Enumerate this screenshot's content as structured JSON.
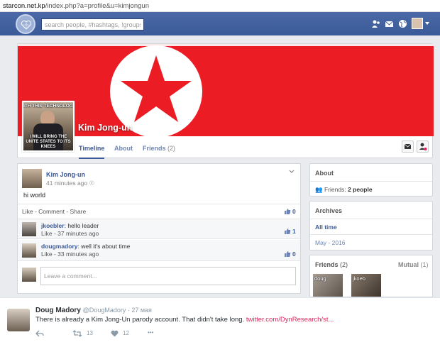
{
  "browser": {
    "url_host": "starcon.net.kp",
    "url_path": "/index.php?a=profile&u=kimjongun"
  },
  "header": {
    "search_placeholder": "search people, #hashtags, !groups",
    "icons": [
      "friends-icon",
      "messages-icon",
      "globe-icon"
    ]
  },
  "profile": {
    "name": "Kim Jong-un",
    "picture_text_top": "ITH THIS TECHNOLOG",
    "picture_text_bottom": "I WILL BRING THE UNITE STATES TO ITS KNEES",
    "tabs": [
      {
        "label": "Timeline",
        "count": ""
      },
      {
        "label": "About",
        "count": ""
      },
      {
        "label": "Friends",
        "count": "(2)"
      }
    ],
    "accent_color": "#3b5998",
    "cover_color": "#ec1c24"
  },
  "post": {
    "author": "Kim Jong-un",
    "time": "41 minutes ago",
    "text": "hi world",
    "actions": "Like - Comment - Share",
    "likes": "0",
    "comments": [
      {
        "user": "jkoebler",
        "text": ": hello leader",
        "meta": "Like - 37 minutes ago",
        "likes": "1"
      },
      {
        "user": "dougmadory",
        "text": ": well it's about time",
        "meta": "Like - 33 minutes ago",
        "likes": "0"
      }
    ],
    "comment_placeholder": "Leave a comment..."
  },
  "sidebar": {
    "about_title": "About",
    "friends_label": "Friends:",
    "friends_value": "2 people",
    "archives_title": "Archives",
    "archives_all": "All time",
    "archives_month": "May - 2016",
    "friends_title": "Friends",
    "friends_count": "(2)",
    "mutual_title": "Mutual",
    "mutual_count": "(1)",
    "friend_thumbs": [
      "doug",
      "jkoeb"
    ]
  },
  "tweet": {
    "name": "Doug Madory",
    "handle": "@DougMadory · 27 мая",
    "text": "There is already a Kim Jong-Un parody account. That didn't take long. ",
    "link": "twitter.com/DynResearch/st...",
    "retweets": "13",
    "likes": "12",
    "more": "•••"
  }
}
